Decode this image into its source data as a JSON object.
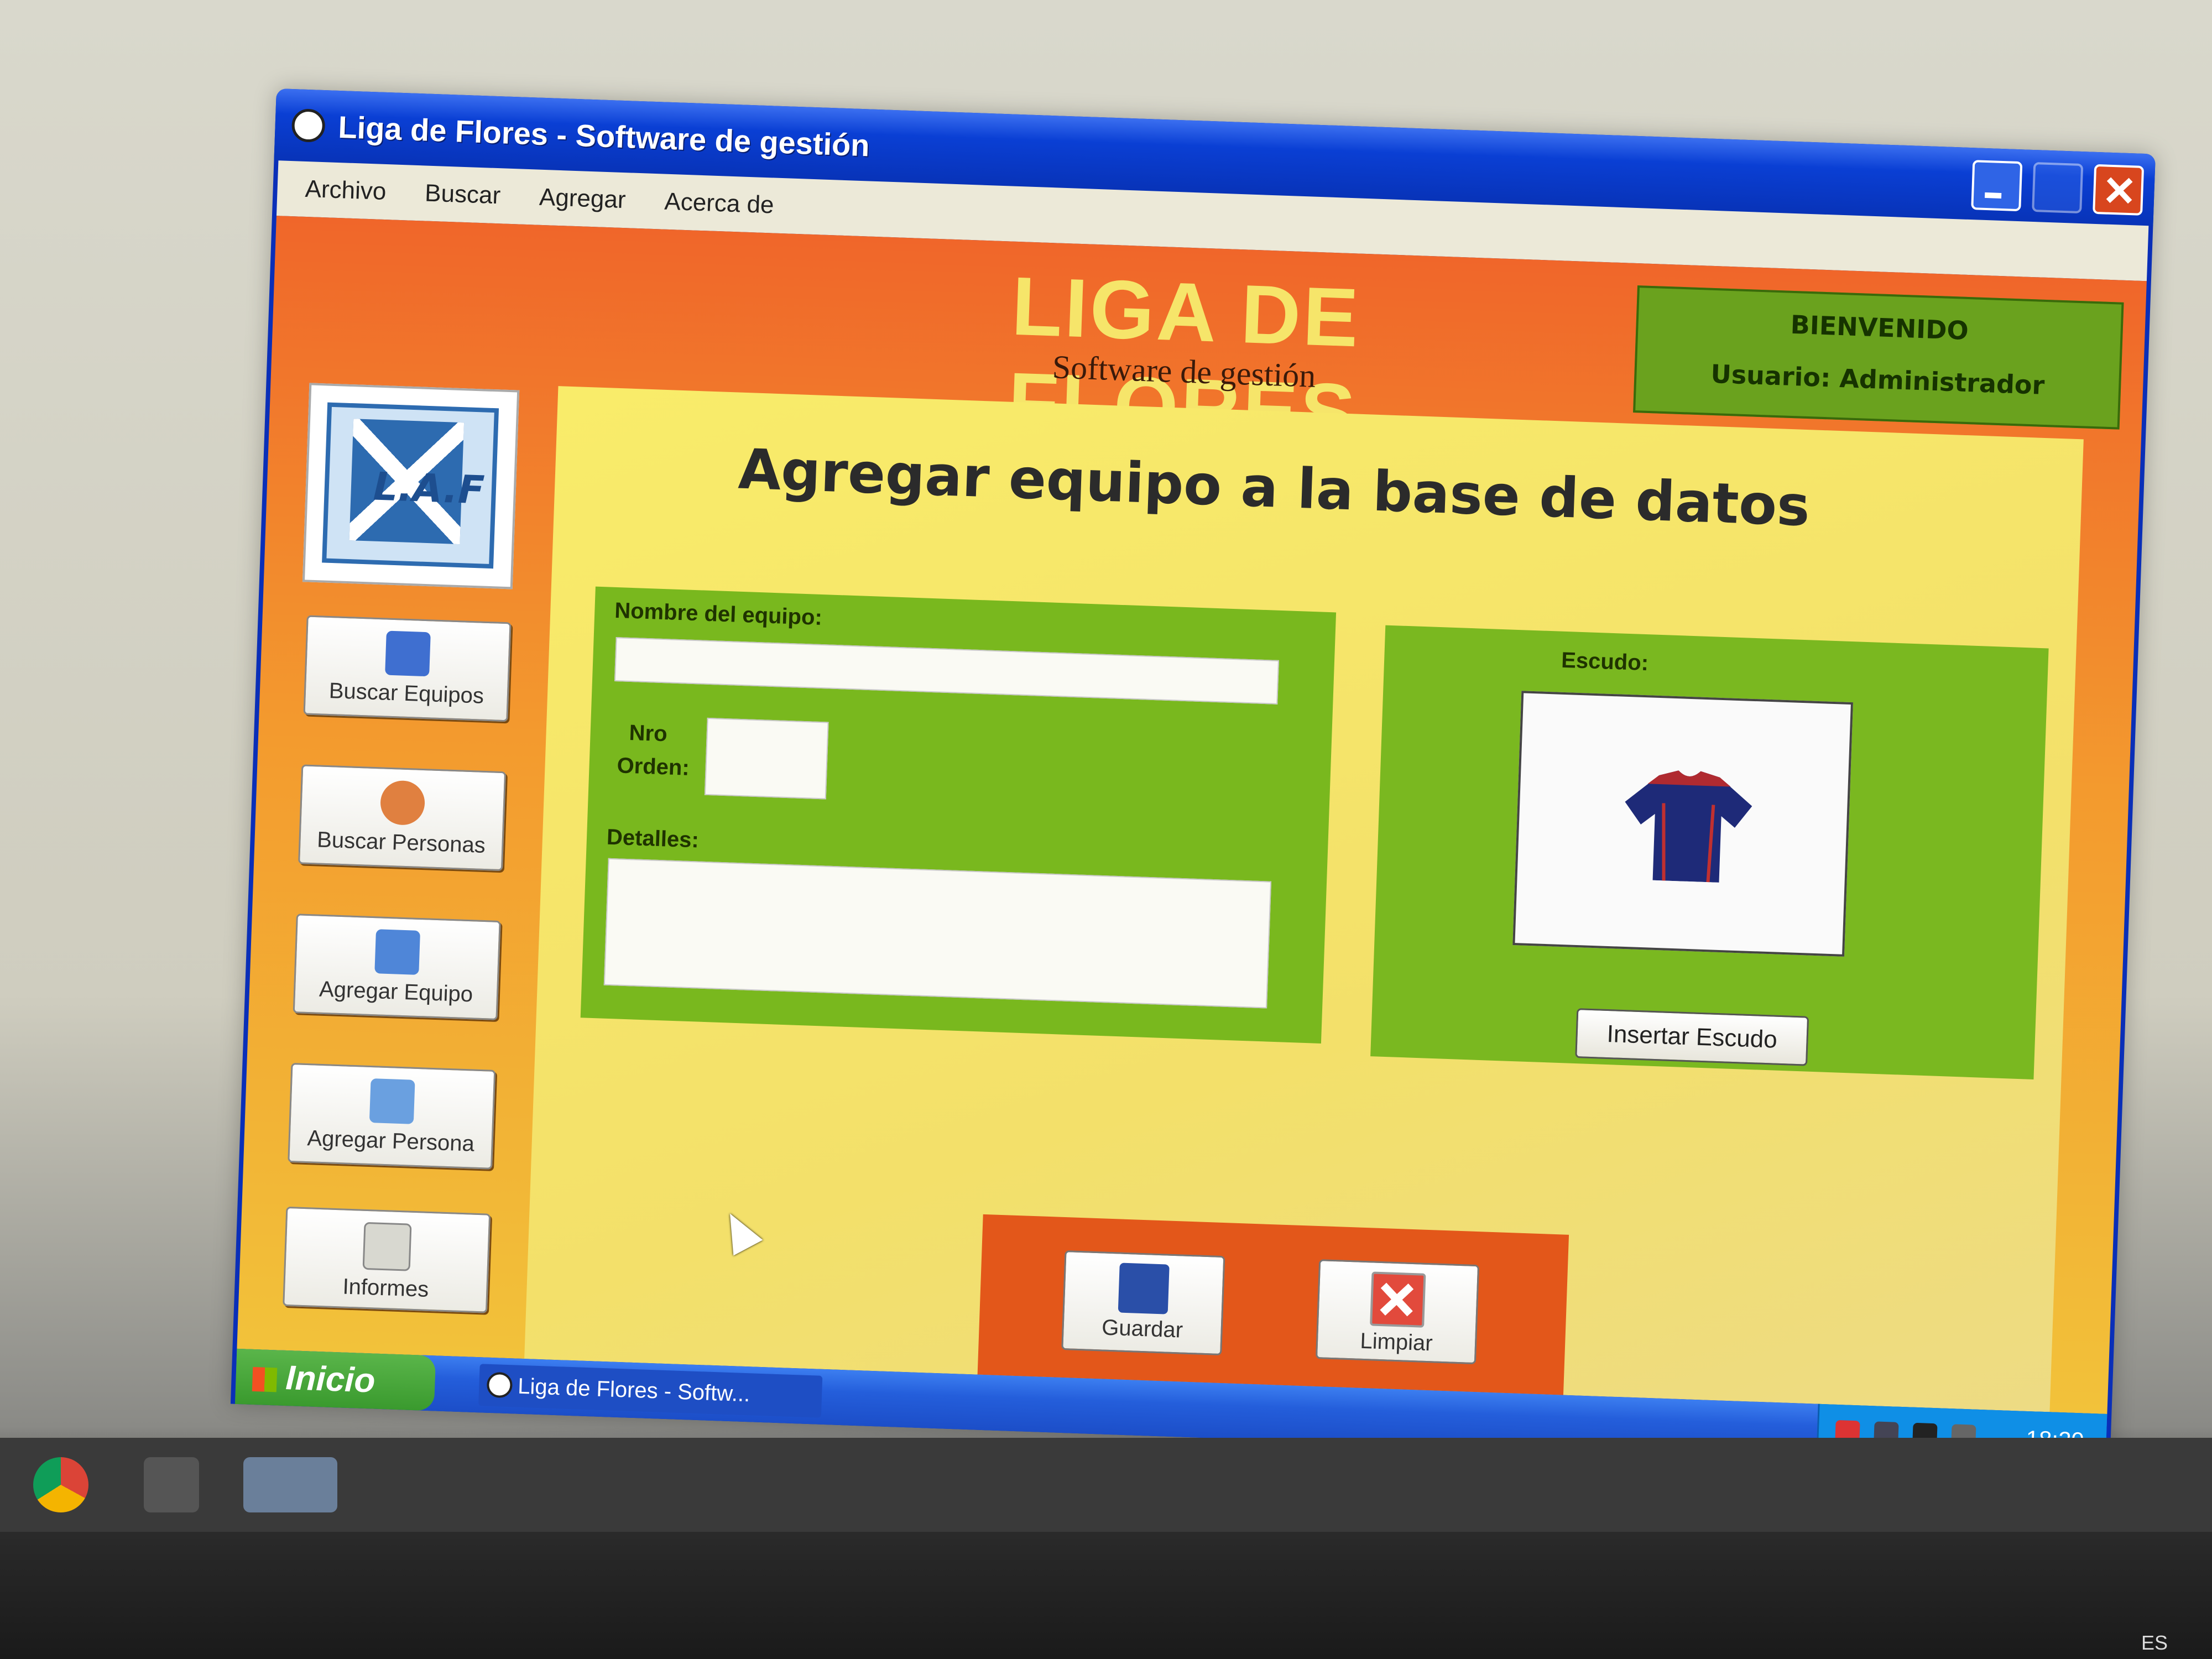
{
  "window": {
    "title": "Liga de Flores - Software de gestión"
  },
  "menu": [
    "Archivo",
    "Buscar",
    "Agregar",
    "Acerca de"
  ],
  "header": {
    "title": "LIGA DE FLORES",
    "subtitle": "Software de gestión"
  },
  "welcome": {
    "line1": "BIENVENIDO",
    "line2": "Usuario: Administrador"
  },
  "logo": {
    "text": "L.A.F"
  },
  "sidebar": [
    {
      "label": "Buscar Equipos",
      "icon": "search-team-icon"
    },
    {
      "label": "Buscar Personas",
      "icon": "search-person-icon"
    },
    {
      "label": "Agregar Equipo",
      "icon": "add-team-icon"
    },
    {
      "label": "Agregar Persona",
      "icon": "add-person-icon"
    },
    {
      "label": "Informes",
      "icon": "report-icon"
    }
  ],
  "page": {
    "title": "Agregar equipo a la base de datos"
  },
  "form": {
    "team_name_label": "Nombre del equipo:",
    "team_name_value": "",
    "order_label_1": "Nro",
    "order_label_2": "Orden:",
    "order_value": "",
    "details_label": "Detalles:",
    "details_value": ""
  },
  "escudo": {
    "label": "Escudo:",
    "insert_button": "Insertar Escudo",
    "image_icon": "shirt-icon"
  },
  "actions": {
    "save": "Guardar",
    "clear": "Limpiar"
  },
  "taskbar": {
    "start": "Inicio",
    "task": "Liga de Flores - Softw...",
    "clock": "18:20"
  },
  "host": {
    "lang": "ES"
  },
  "colors": {
    "title_bar": "#0a3fd4",
    "header_orange": "#f0662a",
    "panel_yellow": "#f9ec6a",
    "form_green": "#79b81e",
    "action_orange": "#e3571a"
  }
}
